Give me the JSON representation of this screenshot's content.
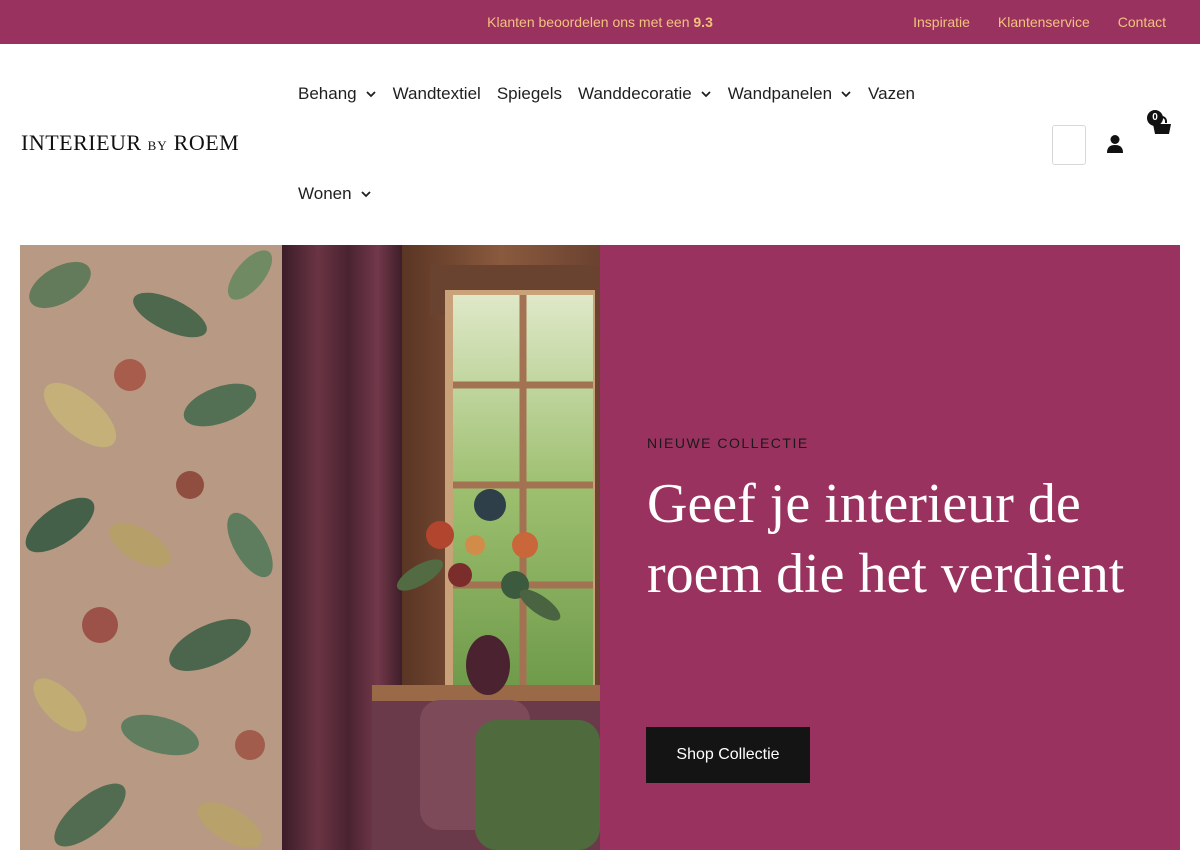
{
  "topbar": {
    "rating_prefix": "Klanten beoordelen ons met een ",
    "rating_score": "9.3",
    "links": [
      "Inspiratie",
      "Klantenservice",
      "Contact"
    ]
  },
  "header": {
    "logo": {
      "part1": "INTERIEUR",
      "part2": "BY",
      "part3": "ROEM"
    },
    "nav": [
      {
        "label": "Behang",
        "has_dropdown": true
      },
      {
        "label": "Wandtextiel",
        "has_dropdown": false
      },
      {
        "label": "Spiegels",
        "has_dropdown": false
      },
      {
        "label": "Wanddecoratie",
        "has_dropdown": true
      },
      {
        "label": "Wandpanelen",
        "has_dropdown": true
      },
      {
        "label": "Vazen",
        "has_dropdown": false
      },
      {
        "label": "Wonen",
        "has_dropdown": true
      }
    ],
    "cart_count": "0",
    "icons": [
      "search-field",
      "account-icon",
      "cart-icon",
      "chevron-down-icon"
    ]
  },
  "hero": {
    "eyebrow": "NIEUWE COLLECTIE",
    "headline": "Geef je interieur de roem die het verdient",
    "cta_label": "Shop Collectie"
  },
  "colors": {
    "brand": "#9a325f",
    "topbar_text": "#f2c27d",
    "cta_bg": "#141414"
  }
}
